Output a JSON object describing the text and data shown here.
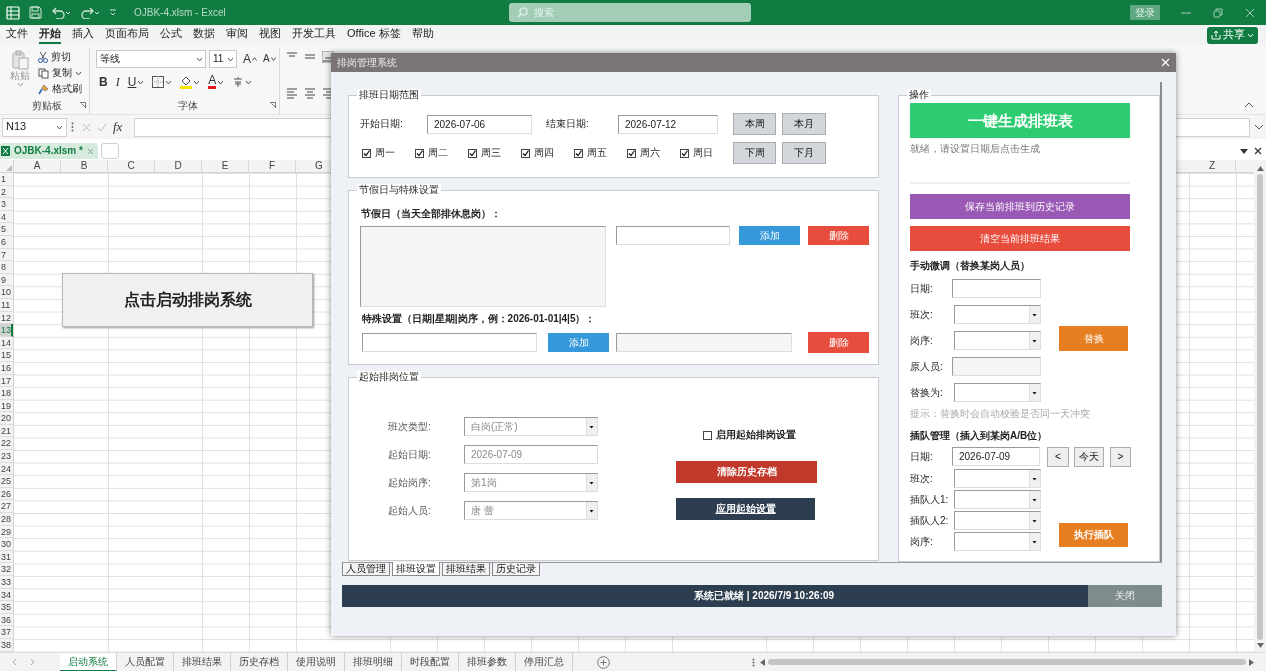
{
  "window": {
    "title": "OJBK-4.xlsm - Excel",
    "search_placeholder": "搜索",
    "login_button": "登录"
  },
  "menu_tabs": [
    {
      "label": "文件",
      "selected": false
    },
    {
      "label": "开始",
      "selected": true
    },
    {
      "label": "插入",
      "selected": false
    },
    {
      "label": "页面布局",
      "selected": false
    },
    {
      "label": "公式",
      "selected": false
    },
    {
      "label": "数据",
      "selected": false
    },
    {
      "label": "审阅",
      "selected": false
    },
    {
      "label": "视图",
      "selected": false
    },
    {
      "label": "开发工具",
      "selected": false
    },
    {
      "label": "Office 标签",
      "selected": false
    },
    {
      "label": "帮助",
      "selected": false
    }
  ],
  "share_button": "共享",
  "ribbon": {
    "clipboard": {
      "paste": {
        "label": "粘贴",
        "disabled": true
      },
      "cut": "剪切",
      "copy": "复制",
      "format_painter": "格式刷",
      "group_label": "剪贴板"
    },
    "font": {
      "font_name": "等线",
      "font_size": "11",
      "grow": "A",
      "shrink": "A",
      "bold": "B",
      "italic": "I",
      "underline": "U",
      "font_color": "A",
      "group_label": "字体"
    }
  },
  "formula_bar": {
    "name_box": "N13",
    "fx": "fx"
  },
  "workbook_tab": "OJBK-4.xlsm *",
  "sheet": {
    "columns": [
      "A",
      "B",
      "C",
      "D",
      "E",
      "F",
      "G",
      "Z"
    ],
    "rows": [
      {
        "label": "1",
        "selected": false
      },
      {
        "label": "2",
        "selected": false
      },
      {
        "label": "3",
        "selected": false
      },
      {
        "label": "4",
        "selected": false
      },
      {
        "label": "5",
        "selected": false
      },
      {
        "label": "6",
        "selected": false
      },
      {
        "label": "7",
        "selected": false
      },
      {
        "label": "8",
        "selected": false
      },
      {
        "label": "9",
        "selected": false
      },
      {
        "label": "10",
        "selected": false
      },
      {
        "label": "11",
        "selected": false
      },
      {
        "label": "12",
        "selected": false
      },
      {
        "label": "13",
        "selected": true
      },
      {
        "label": "14",
        "selected": false
      },
      {
        "label": "15",
        "selected": false
      },
      {
        "label": "16",
        "selected": false
      },
      {
        "label": "17",
        "selected": false
      },
      {
        "label": "18",
        "selected": false
      },
      {
        "label": "19",
        "selected": false
      },
      {
        "label": "20",
        "selected": false
      },
      {
        "label": "21",
        "selected": false
      },
      {
        "label": "22",
        "selected": false
      },
      {
        "label": "23",
        "selected": false
      },
      {
        "label": "24",
        "selected": false
      },
      {
        "label": "25",
        "selected": false
      },
      {
        "label": "26",
        "selected": false
      },
      {
        "label": "27",
        "selected": false
      },
      {
        "label": "28",
        "selected": false
      },
      {
        "label": "29",
        "selected": false
      },
      {
        "label": "30",
        "selected": false
      },
      {
        "label": "31",
        "selected": false
      },
      {
        "label": "32",
        "selected": false
      },
      {
        "label": "33",
        "selected": false
      },
      {
        "label": "34",
        "selected": false
      },
      {
        "label": "35",
        "selected": false
      },
      {
        "label": "36",
        "selected": false
      },
      {
        "label": "37",
        "selected": false
      },
      {
        "label": "38",
        "selected": false
      }
    ],
    "launch_button": "点击启动排岗系统"
  },
  "sheet_tabs": [
    {
      "label": "启动系统",
      "selected": true
    },
    {
      "label": "人员配置",
      "selected": false
    },
    {
      "label": "排班结果",
      "selected": false
    },
    {
      "label": "历史存档",
      "selected": false
    },
    {
      "label": "使用说明",
      "selected": false
    },
    {
      "label": "排班明细",
      "selected": false
    },
    {
      "label": "时段配置",
      "selected": false
    },
    {
      "label": "排班参数",
      "selected": false
    },
    {
      "label": "停用汇总",
      "selected": false
    }
  ],
  "dialog": {
    "title": "排岗管理系统",
    "date_range": {
      "legend": "排班日期范围",
      "start_label": "开始日期:",
      "start_value": "2026-07-06",
      "end_label": "结束日期:",
      "end_value": "2026-07-12",
      "buttons": [
        "本周",
        "本月",
        "下周",
        "下月"
      ],
      "weekdays": [
        {
          "label": "周一",
          "checked": true
        },
        {
          "label": "周二",
          "checked": true
        },
        {
          "label": "周三",
          "checked": true
        },
        {
          "label": "周四",
          "checked": true
        },
        {
          "label": "周五",
          "checked": true
        },
        {
          "label": "周六",
          "checked": true
        },
        {
          "label": "周日",
          "checked": true
        }
      ]
    },
    "holiday": {
      "legend": "节假日与特殊设置",
      "holiday_label": "节假日（当天全部排休息岗）：",
      "add_button": "添加",
      "delete_button": "删除",
      "special_label": "特殊设置（日期|星期|岗序，例：2026-01-01|4|5）：",
      "special_add_button": "添加",
      "special_delete_button": "删除"
    },
    "start_position": {
      "legend": "起始排岗位置",
      "fields": [
        {
          "label": "班次类型:",
          "value": "白岗(正常)",
          "kind": "select",
          "disabled": true
        },
        {
          "label": "起始日期:",
          "value": "2026-07-09",
          "kind": "text",
          "disabled": true
        },
        {
          "label": "起始岗序:",
          "value": "第1岗",
          "kind": "select",
          "disabled": true
        },
        {
          "label": "起始人员:",
          "value": "唐 蕾",
          "kind": "select",
          "disabled": true
        }
      ],
      "enable": {
        "label": "启用起始排岗设置",
        "checked": false
      },
      "clear_button": "清除历史存档",
      "apply_button": "应用起始设置"
    },
    "actions": {
      "legend": "操作",
      "generate_button": "一键生成排班表",
      "status": "就绪，请设置日期后点击生成",
      "save_button": "保存当前排班到历史记录",
      "clear_button": "清空当前排班结果",
      "manual_title": "手动微调（替换某岗人员）",
      "manual_fields": [
        {
          "label": "日期:",
          "kind": "text"
        },
        {
          "label": "班次:",
          "kind": "select"
        },
        {
          "label": "岗序:",
          "kind": "select"
        },
        {
          "label": "原人员:",
          "kind": "readonly"
        },
        {
          "label": "替换为:",
          "kind": "select"
        }
      ],
      "replace_button": "替换",
      "hint": "提示：替换时会自动校验是否同一天冲突",
      "queue_title": "插队管理（插入到某岗A/B位）",
      "queue_date": {
        "label": "日期:",
        "value": "2026-07-09"
      },
      "prev_button": "<",
      "today_button": "今天",
      "next_button": ">",
      "queue_fields": [
        {
          "label": "班次:",
          "kind": "select"
        },
        {
          "label": "插队人1:",
          "kind": "select"
        },
        {
          "label": "插队人2:",
          "kind": "select"
        },
        {
          "label": "岗序:",
          "kind": "select"
        }
      ],
      "queue_button": "执行插队"
    },
    "tabs": [
      {
        "label": "人员管理",
        "selected": false
      },
      {
        "label": "排班设置",
        "selected": true
      },
      {
        "label": "排班结果",
        "selected": false
      },
      {
        "label": "历史记录",
        "selected": false
      }
    ],
    "status_text": "系统已就绪 | 2026/7/9 10:26:09",
    "close_button": "关闭"
  }
}
